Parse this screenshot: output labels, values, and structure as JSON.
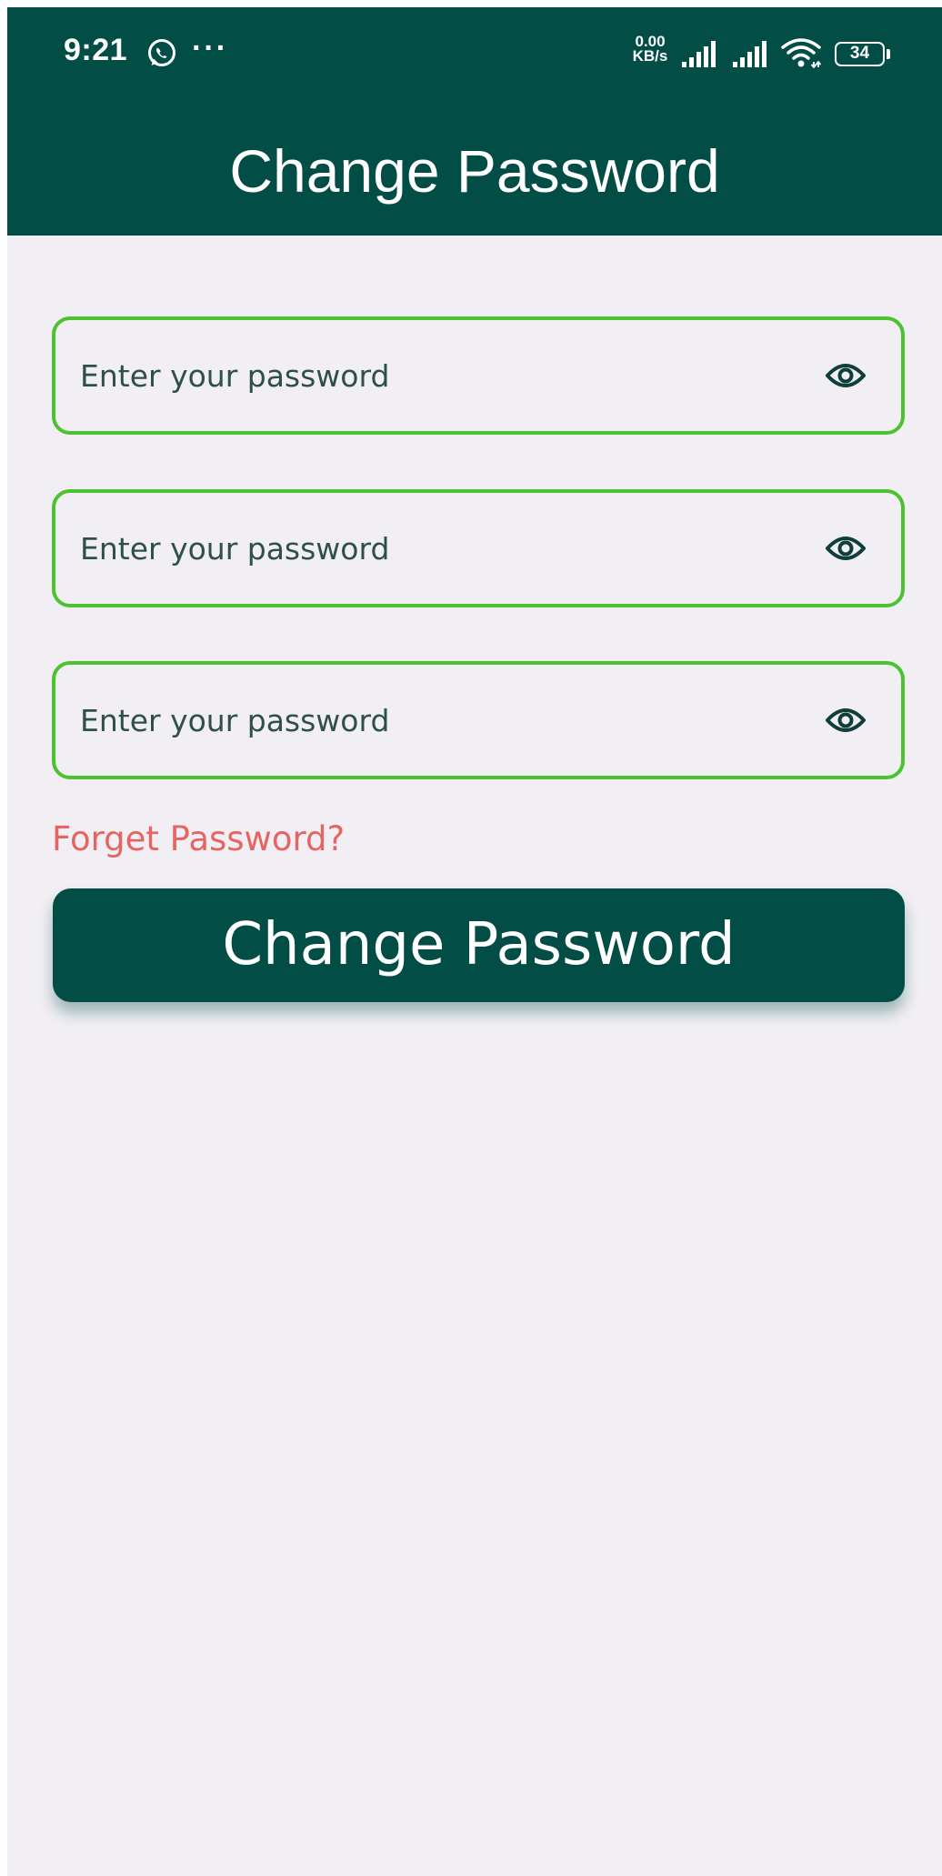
{
  "status_bar": {
    "time": "9:21",
    "more_indicator": "···",
    "speed_value": "0.00",
    "speed_unit": "KB/s",
    "battery_level": "34",
    "icons": [
      "whatsapp-icon",
      "signal-icon",
      "signal-icon",
      "wifi-icon",
      "battery-icon"
    ]
  },
  "header": {
    "title": "Change Password"
  },
  "form": {
    "fields": [
      {
        "placeholder": "Enter your password",
        "value": "",
        "icon": "eye-icon"
      },
      {
        "placeholder": "Enter your password",
        "value": "",
        "icon": "eye-icon"
      },
      {
        "placeholder": "Enter your password",
        "value": "",
        "icon": "eye-icon"
      }
    ],
    "forgot_label": "Forget Password?",
    "submit_label": "Change Password"
  },
  "colors": {
    "primary": "#024d45",
    "background": "#f1eff3",
    "field_border": "#4cc22f",
    "link": "#e56464",
    "on_primary": "#ffffff"
  }
}
